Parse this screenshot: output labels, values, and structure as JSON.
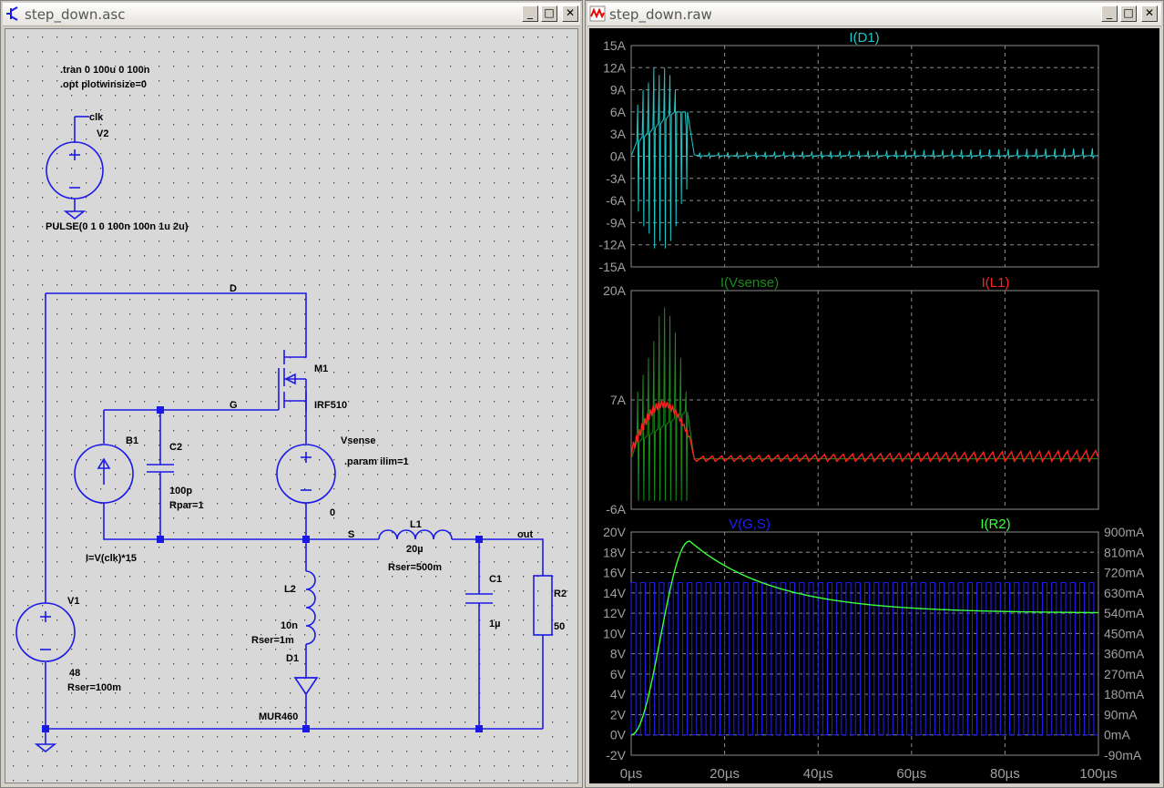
{
  "schematic_window": {
    "title": "step_down.asc",
    "directives": [
      ".tran 0 100u 0 100n",
      ".opt plotwinsize=0"
    ],
    "labels": {
      "clk": "clk",
      "v2": "V2",
      "pulse": "PULSE(0 1 0 100n 100n 1u 2u)",
      "net_d": "D",
      "m1": "M1",
      "irf510": "IRF510",
      "net_g": "G",
      "b1": "B1",
      "c2": "C2",
      "c2_val": "100p",
      "c2_rpar": "Rpar=1",
      "vsense": "Vsense",
      "param": ".param ilim=1",
      "vsense_val": "0",
      "b1_expr": "I=V(clk)*15",
      "net_s": "S",
      "l1": "L1",
      "l1_val": "20µ",
      "l1_rser": "Rser=500m",
      "net_out": "out",
      "c1": "C1",
      "c1_val": "1µ",
      "r2": "R2",
      "r2_val": "50",
      "l2": "L2",
      "l2_val": "10n",
      "l2_rser": "Rser=1m",
      "d1": "D1",
      "d1_model": "MUR460",
      "v1": "V1",
      "v1_val": "48",
      "v1_rser": "Rser=100m"
    }
  },
  "waveform_window": {
    "title": "step_down.raw",
    "x_ticks": [
      "0µs",
      "20µs",
      "40µs",
      "60µs",
      "80µs",
      "100µs"
    ]
  },
  "window_buttons": {
    "minimize": "_",
    "maximize": "□",
    "close": "✕"
  },
  "colors": {
    "cyan": "#1fc8c8",
    "green": "#1a8a1a",
    "red": "#ff2020",
    "blue": "#1f1fff",
    "lime": "#3cff3c",
    "wire": "#1a1ae6"
  },
  "chart_data": [
    {
      "type": "line",
      "series": [
        {
          "name": "I(D1)",
          "color": "#1fc8c8"
        }
      ],
      "x": [
        0,
        100
      ],
      "xlim": [
        0,
        100
      ],
      "ylim": [
        -15,
        15
      ],
      "yticks": [
        "15A",
        "12A",
        "9A",
        "6A",
        "3A",
        "0A",
        "-3A",
        "-6A",
        "-9A",
        "-12A",
        "-15A"
      ]
    },
    {
      "type": "line",
      "series": [
        {
          "name": "I(Vsense)",
          "color": "#1a8a1a"
        },
        {
          "name": "I(L1)",
          "color": "#ff2020"
        }
      ],
      "xlim": [
        0,
        100
      ],
      "ylim": [
        -6,
        20
      ],
      "yticks": [
        "20A",
        "7A",
        "-6A"
      ]
    },
    {
      "type": "line",
      "series": [
        {
          "name": "V(G,S)",
          "color": "#1f1fff"
        },
        {
          "name": "I(R2)",
          "color": "#3cff3c"
        }
      ],
      "xlim": [
        0,
        100
      ],
      "ylim": [
        -2,
        20
      ],
      "yticks": [
        "20V",
        "18V",
        "16V",
        "14V",
        "12V",
        "10V",
        "8V",
        "6V",
        "4V",
        "2V",
        "0V",
        "-2V"
      ],
      "ylim_right": [
        -90,
        900
      ],
      "yticks_right": [
        "900mA",
        "810mA",
        "720mA",
        "630mA",
        "540mA",
        "450mA",
        "360mA",
        "270mA",
        "180mA",
        "90mA",
        "0mA",
        "-90mA"
      ]
    }
  ]
}
